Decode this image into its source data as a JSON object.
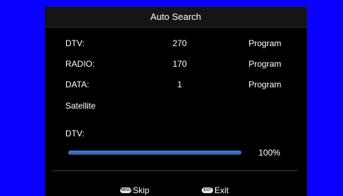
{
  "title": "Auto Search",
  "rows": [
    {
      "label": "DTV:",
      "count": "270",
      "unit": "Program"
    },
    {
      "label": "RADIO:",
      "count": "170",
      "unit": "Program"
    },
    {
      "label": "DATA:",
      "count": "1",
      "unit": "Program"
    }
  ],
  "satellite_label": "Satellite",
  "progress_label": "DTV:",
  "progress": {
    "percent_text": "100%",
    "value": 1.0
  },
  "footer": {
    "skip_key": "MENU",
    "skip_label": "Skip",
    "exit_key": "EXIT",
    "exit_label": "Exit"
  },
  "colors": {
    "background": "#0a00ff",
    "panel": "#000000",
    "progress_fill": "#3b6fbd"
  }
}
